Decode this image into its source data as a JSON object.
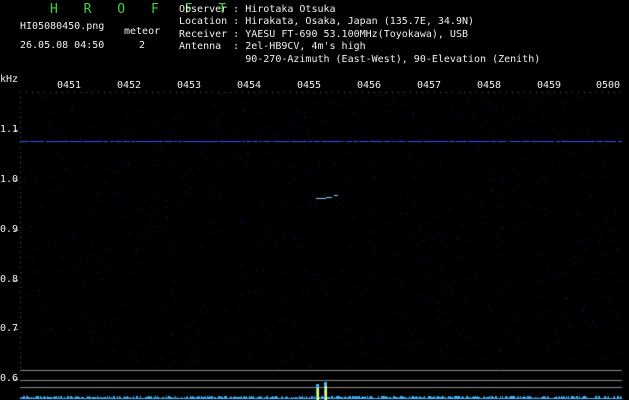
{
  "header": {
    "title": "H R O F F T",
    "filename": "HI05080450.png",
    "meteor_label": "meteor",
    "meteor_count": "2",
    "datetime": "26.05.08 04:50"
  },
  "info": {
    "observer": "Observer : Hirotaka Otsuka",
    "location": "Location : Hirakata, Osaka, Japan (135.7E, 34.9N)",
    "receiver": "Receiver : YAESU FT-690 53.100MHz(Toyokawa), USB",
    "antenna": "Antenna  : 2el-HB9CV, 4m's high",
    "antenna_line2": "           90-270-Azimuth (East-West), 90-Elevation (Zenith)"
  },
  "axes": {
    "y_unit": "kHz",
    "time_labels": [
      "0451",
      "0452",
      "0453",
      "0454",
      "0455",
      "0456",
      "0457",
      "0458",
      "0459",
      "0500"
    ],
    "freq_labels": [
      "1.1",
      "1.0",
      "0.9",
      "0.8",
      "0.7",
      "0.6"
    ]
  },
  "colors": {
    "title": "#3cd23c",
    "carrier": "#3a4cff",
    "noise": "#1a2a8a",
    "meteor": "#7fd0ff",
    "spectrum": "#3cb4ff",
    "spectrum_peak": "#ffff40"
  }
}
